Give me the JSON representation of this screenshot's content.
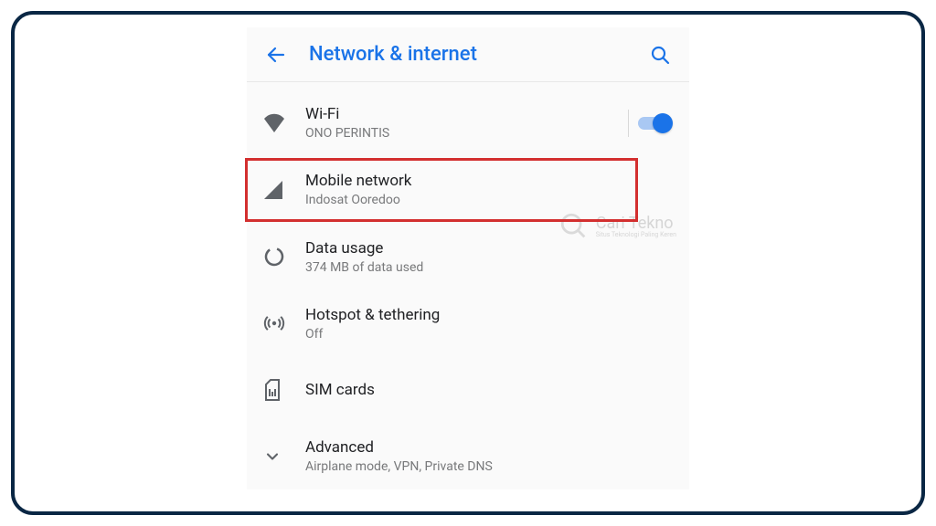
{
  "header": {
    "title": "Network & internet"
  },
  "items": {
    "wifi": {
      "title": "Wi-Fi",
      "subtitle": "ONO PERINTIS",
      "switch_on": true
    },
    "mobile": {
      "title": "Mobile network",
      "subtitle": "Indosat Ooredoo",
      "highlighted": true
    },
    "data": {
      "title": "Data usage",
      "subtitle": "374 MB of data used"
    },
    "hotspot": {
      "title": "Hotspot & tethering",
      "subtitle": "Off"
    },
    "sim": {
      "title": "SIM cards"
    },
    "advanced": {
      "title": "Advanced",
      "subtitle": "Airplane mode, VPN, Private DNS"
    }
  },
  "watermark": {
    "main": "Cari Tekno",
    "sub": "Situs Teknologi Paling Keren"
  },
  "colors": {
    "primary": "#1a73e8",
    "frame": "#0a2744",
    "highlight": "#d32f2f",
    "text_primary": "#202124",
    "text_secondary": "#78797b",
    "icon": "#5f6368"
  }
}
